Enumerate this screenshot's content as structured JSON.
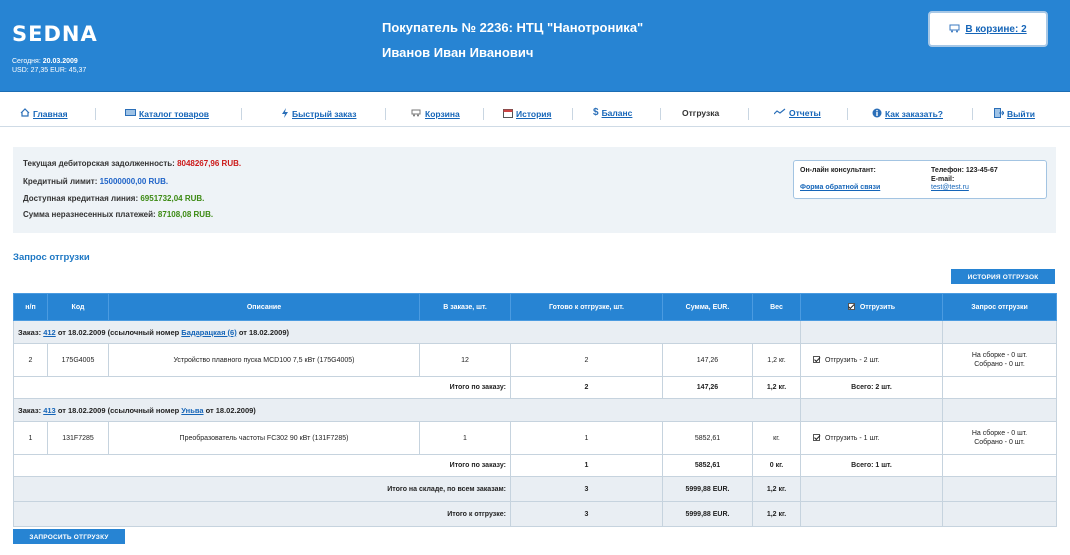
{
  "header": {
    "logo": "SEDNA",
    "today_label": "Сегодня:",
    "today_date": "20.03.2009",
    "rates": "USD: 27,35 EUR: 45,37",
    "buyer": "Покупатель № 2236: НТЦ \"Нанотроника\"",
    "person": "Иванов Иван Иванович",
    "cart_link": "В корзине: 2"
  },
  "nav": [
    {
      "label": "Главная",
      "icon": "home-icon"
    },
    {
      "label": "Каталог товаров",
      "icon": "catalog-icon"
    },
    {
      "label": "Быстрый заказ",
      "icon": "lightning-icon"
    },
    {
      "label": "Корзина",
      "icon": "cart-icon"
    },
    {
      "label": "История",
      "icon": "calendar-icon"
    },
    {
      "label": "Баланс",
      "icon": "dollar-icon"
    },
    {
      "label": "Отгрузка",
      "icon": "truck-icon"
    },
    {
      "label": "Отчеты",
      "icon": "chart-icon"
    },
    {
      "label": "Как заказать?",
      "icon": "info-icon"
    },
    {
      "label": "Выйти",
      "icon": "exit-icon"
    }
  ],
  "info": {
    "debt_label": "Текущая дебиторская задолженность:",
    "debt_value": "8048267,96 RUB.",
    "credit_label": "Кредитный лимит:",
    "credit_value": "15000000,00 RUB.",
    "available_label": "Доступная кредитная линия:",
    "available_value": "6951732,04 RUB.",
    "unassigned_label": "Сумма неразнесенных платежей:",
    "unassigned_value": "87108,08 RUB."
  },
  "consultant": {
    "title": "Он-лайн консультант:",
    "phone_label": "Телефон: 123-45-67",
    "email_label": "E-mail:",
    "feedback_link": "Форма обратной связи",
    "email": "test@test.ru"
  },
  "section_title": "Запрос отгрузки",
  "history_button": "ИСТОРИЯ ОТГРУЗОК",
  "request_button": "ЗАПРОСИТЬ ОТГРУЗКУ",
  "table": {
    "headers": [
      "н/п",
      "Код",
      "Описание",
      "В заказе, шт.",
      "Готово к отгрузке, шт.",
      "Сумма, EUR.",
      "Вес",
      "Отгрузить",
      "Запрос отгрузки"
    ],
    "orders": [
      {
        "prefix": "Заказ:",
        "number": "412",
        "date_text": "от 18.02.2009 (ссылочный номер",
        "ref": "Бадарацкая (6)",
        "ref_date": "от 18.02.2009)",
        "item": {
          "n": "2",
          "code": "175G4005",
          "desc": "Устройство плавного пуска MCD100 7,5 кВт (175G4005)",
          "ordered": "12",
          "ready": "2",
          "sum": "147,26",
          "weight": "1,2 кг.",
          "ship": "Отгрузить - 2 шт.",
          "req1": "На сборке - 0 шт.",
          "req2": "Собрано - 0 шт."
        },
        "subtotal": {
          "label": "Итого по заказу:",
          "ready": "2",
          "sum": "147,26",
          "weight": "1,2 кг.",
          "total": "Всего: 2 шт."
        }
      },
      {
        "prefix": "Заказ:",
        "number": "413",
        "date_text": "от 18.02.2009 (ссылочный номер",
        "ref": "Уньва",
        "ref_date": "от 18.02.2009)",
        "item": {
          "n": "1",
          "code": "131F7285",
          "desc": "Преобразователь частоты FC302 90 кВт (131F7285)",
          "ordered": "1",
          "ready": "1",
          "sum": "5852,61",
          "weight": "кг.",
          "ship": "Отгрузить - 1 шт.",
          "req1": "На сборке - 0 шт.",
          "req2": "Собрано - 0 шт."
        },
        "subtotal": {
          "label": "Итого по заказу:",
          "ready": "1",
          "sum": "5852,61",
          "weight": "0 кг.",
          "total": "Всего: 1 шт."
        }
      }
    ],
    "totals": [
      {
        "label": "Итого на складе, по всем заказам:",
        "ready": "3",
        "sum": "5999,88 EUR.",
        "weight": "1,2 кг."
      },
      {
        "label": "Итого к отгрузке:",
        "ready": "3",
        "sum": "5999,88 EUR.",
        "weight": "1,2 кг."
      }
    ]
  }
}
